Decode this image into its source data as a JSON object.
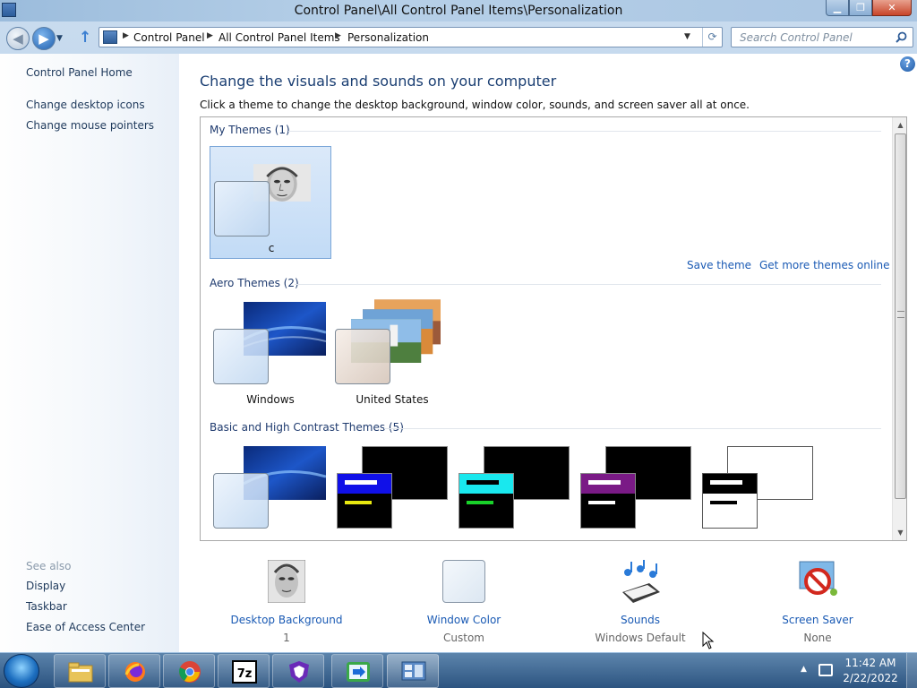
{
  "window": {
    "title": "Control Panel\\All Control Panel Items\\Personalization"
  },
  "address": {
    "crumbs": [
      "Control Panel",
      "All Control Panel Items",
      "Personalization"
    ]
  },
  "search": {
    "placeholder": "Search Control Panel"
  },
  "sidebar": {
    "home": "Control Panel Home",
    "links": [
      "Change desktop icons",
      "Change mouse pointers"
    ],
    "see_also_label": "See also",
    "see_also": [
      "Display",
      "Taskbar",
      "Ease of Access Center"
    ]
  },
  "main": {
    "heading": "Change the visuals and sounds on your computer",
    "subheading": "Click a theme to change the desktop background, window color, sounds, and screen saver all at once."
  },
  "themes": {
    "my_themes_header": "My Themes (1)",
    "my_themes": [
      {
        "label": "c",
        "selected": true
      }
    ],
    "save_theme": "Save theme",
    "get_more": "Get more themes online",
    "aero_header": "Aero Themes (2)",
    "aero": [
      {
        "label": "Windows"
      },
      {
        "label": "United States"
      }
    ],
    "basic_header": "Basic and High Contrast Themes (5)",
    "basic_count": 5
  },
  "bottom": {
    "items": [
      {
        "label": "Desktop Background",
        "value": "1",
        "icon": "desktop-background-icon"
      },
      {
        "label": "Window Color",
        "value": "Custom",
        "icon": "window-color-icon"
      },
      {
        "label": "Sounds",
        "value": "Windows Default",
        "icon": "sounds-icon"
      },
      {
        "label": "Screen Saver",
        "value": "None",
        "icon": "screen-saver-icon"
      }
    ]
  },
  "taskbar": {
    "apps": [
      "file-explorer-icon",
      "firefox-icon",
      "chrome-icon",
      "7zip-icon",
      "brave-icon",
      "remote-desktop-icon",
      "control-panel-icon"
    ],
    "time": "11:42 AM",
    "date": "2/22/2022"
  },
  "colors": {
    "link": "#1a5ab4",
    "heading": "#1a3e72",
    "selection": "#c2dbf6"
  }
}
